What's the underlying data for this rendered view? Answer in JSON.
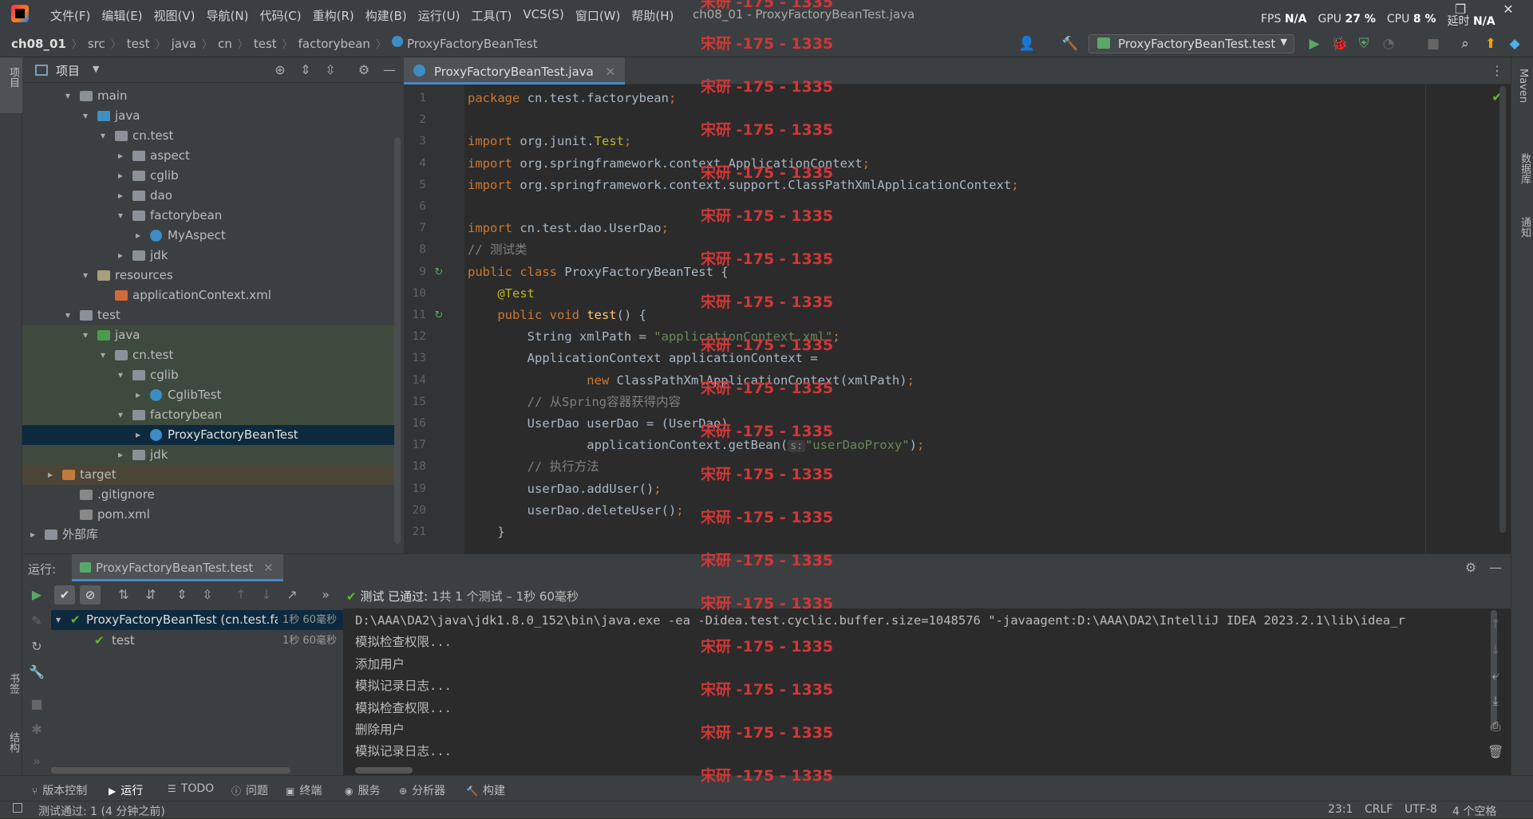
{
  "menu": [
    "文件(F)",
    "编辑(E)",
    "视图(V)",
    "导航(N)",
    "代码(C)",
    "重构(R)",
    "构建(B)",
    "运行(U)",
    "工具(T)",
    "VCS(S)",
    "窗口(W)",
    "帮助(H)"
  ],
  "window_title": "ch08_01 - ProxyFactoryBeanTest.java",
  "stats": {
    "fps_label": "FPS",
    "fps": "N/A",
    "gpu_label": "GPU",
    "gpu": "27 %",
    "cpu_label": "CPU",
    "cpu": "8 %",
    "latency_label": "延时",
    "latency": "N/A"
  },
  "breadcrumbs": [
    "ch08_01",
    "src",
    "test",
    "java",
    "cn",
    "test",
    "factorybean",
    "ProxyFactoryBeanTest"
  ],
  "run_config": "ProxyFactoryBeanTest.test",
  "left_strip": {
    "project": "项目",
    "bookmarks": "书签",
    "structure": "结构"
  },
  "right_strip": {
    "maven": "Maven",
    "database": "数据库",
    "notifications": "通知"
  },
  "project_panel": {
    "title": "项目",
    "tree": [
      {
        "label": "main",
        "depth": 2,
        "icon": "folder",
        "arrow": "▾"
      },
      {
        "label": "java",
        "depth": 3,
        "icon": "src",
        "arrow": "▾"
      },
      {
        "label": "cn.test",
        "depth": 4,
        "icon": "folder",
        "arrow": "▾"
      },
      {
        "label": "aspect",
        "depth": 5,
        "icon": "folder",
        "arrow": "▸"
      },
      {
        "label": "cglib",
        "depth": 5,
        "icon": "folder",
        "arrow": "▸"
      },
      {
        "label": "dao",
        "depth": 5,
        "icon": "folder",
        "arrow": "▸"
      },
      {
        "label": "factorybean",
        "depth": 5,
        "icon": "folder",
        "arrow": "▾"
      },
      {
        "label": "MyAspect",
        "depth": 6,
        "icon": "cls",
        "arrow": "▸"
      },
      {
        "label": "jdk",
        "depth": 5,
        "icon": "folder",
        "arrow": "▸"
      },
      {
        "label": "resources",
        "depth": 3,
        "icon": "res",
        "arrow": "▾"
      },
      {
        "label": "applicationContext.xml",
        "depth": 4,
        "icon": "xml",
        "arrow": ""
      },
      {
        "label": "test",
        "depth": 2,
        "icon": "folder",
        "arrow": "▾"
      },
      {
        "label": "java",
        "depth": 3,
        "icon": "test",
        "arrow": "▾",
        "state": "green"
      },
      {
        "label": "cn.test",
        "depth": 4,
        "icon": "folder",
        "arrow": "▾",
        "state": "green"
      },
      {
        "label": "cglib",
        "depth": 5,
        "icon": "folder",
        "arrow": "▾",
        "state": "green"
      },
      {
        "label": "CglibTest",
        "depth": 6,
        "icon": "cls",
        "arrow": "▸",
        "state": "green"
      },
      {
        "label": "factorybean",
        "depth": 5,
        "icon": "folder",
        "arrow": "▾",
        "state": "green"
      },
      {
        "label": "ProxyFactoryBeanTest",
        "depth": 6,
        "icon": "cls",
        "arrow": "▸",
        "state": "selected"
      },
      {
        "label": "jdk",
        "depth": 5,
        "icon": "folder",
        "arrow": "▸",
        "state": "green"
      },
      {
        "label": "target",
        "depth": 1,
        "icon": "target",
        "arrow": "▸",
        "state": "tan"
      },
      {
        "label": ".gitignore",
        "depth": 2,
        "icon": "file",
        "arrow": ""
      },
      {
        "label": "pom.xml",
        "depth": 2,
        "icon": "file",
        "arrow": ""
      },
      {
        "label": "外部库",
        "depth": 0,
        "icon": "folder",
        "arrow": "▸"
      }
    ]
  },
  "editor": {
    "tab": "ProxyFactoryBeanTest.java",
    "lines": [
      [
        [
          "kw",
          "package "
        ],
        [
          "",
          "cn.test.factorybean"
        ],
        [
          "kw",
          ";"
        ]
      ],
      [],
      [
        [
          "kw",
          "import "
        ],
        [
          "",
          "org.junit."
        ],
        [
          "an",
          "Test"
        ],
        [
          "kw",
          ";"
        ]
      ],
      [
        [
          "kw",
          "import "
        ],
        [
          "",
          "org.springframework.context.ApplicationContext"
        ],
        [
          "kw",
          ";"
        ]
      ],
      [
        [
          "kw",
          "import "
        ],
        [
          "",
          "org.springframework.context.support.ClassPathXmlApplicationContext"
        ],
        [
          "kw",
          ";"
        ]
      ],
      [],
      [
        [
          "kw",
          "import "
        ],
        [
          "",
          "cn.test.dao.UserDao"
        ],
        [
          "kw",
          ";"
        ]
      ],
      [
        [
          "cm",
          "// 测试类"
        ]
      ],
      [
        [
          "kw",
          "public class "
        ],
        [
          "",
          "ProxyFactoryBeanTest {"
        ]
      ],
      [
        [
          "an",
          "    @Test"
        ]
      ],
      [
        [
          "kw",
          "    public void "
        ],
        [
          "fn",
          "test"
        ],
        [
          "",
          "() {"
        ]
      ],
      [
        [
          "",
          "        String xmlPath = "
        ],
        [
          "str",
          "\"applicationContext.xml\""
        ],
        [
          "kw",
          ";"
        ]
      ],
      [
        [
          "",
          "        ApplicationContext applicationContext ="
        ]
      ],
      [
        [
          "kw",
          "                new "
        ],
        [
          "",
          "ClassPathXmlApplicationContext(xmlPath)"
        ],
        [
          "kw",
          ";"
        ]
      ],
      [
        [
          "cm",
          "        // 从Spring容器获得内容"
        ]
      ],
      [
        [
          "",
          "        UserDao userDao = (UserDao)"
        ]
      ],
      [
        [
          "",
          "                applicationContext.getBean("
        ],
        [
          "hint",
          "s:"
        ],
        [
          "str",
          "\"userDaoProxy\""
        ],
        [
          "",
          ")"
        ],
        [
          "kw",
          ";"
        ]
      ],
      [
        [
          "cm",
          "        // 执行方法"
        ]
      ],
      [
        [
          "",
          "        userDao.addUser()"
        ],
        [
          "kw",
          ";"
        ]
      ],
      [
        [
          "",
          "        userDao.deleteUser()"
        ],
        [
          "kw",
          ";"
        ]
      ],
      [
        [
          "",
          "    }"
        ]
      ]
    ]
  },
  "run": {
    "label": "运行:",
    "tab": "ProxyFactoryBeanTest.test",
    "status_prefix": "测试 已通过:",
    "status_detail": " 1共 1 个测试 – 1秒 60毫秒",
    "tree": [
      {
        "label": "ProxyFactoryBeanTest (cn.test.fa",
        "time": "1秒 60毫秒"
      },
      {
        "label": "test",
        "time": "1秒 60毫秒"
      }
    ],
    "console": [
      "D:\\AAA\\DA2\\java\\jdk1.8.0_152\\bin\\java.exe -ea -Didea.test.cyclic.buffer.size=1048576 \"-javaagent:D:\\AAA\\DA2\\IntelliJ IDEA 2023.2.1\\lib\\idea_r",
      "模拟检查权限...",
      "添加用户",
      "模拟记录日志...",
      "模拟检查权限...",
      "删除用户",
      "模拟记录日志..."
    ]
  },
  "bottom_tabs": [
    "版本控制",
    "运行",
    "TODO",
    "问题",
    "终端",
    "服务",
    "分析器",
    "构建"
  ],
  "status": {
    "message": "测试通过: 1 (4 分钟之前)",
    "position": "23:1",
    "line_ending": "CRLF",
    "encoding": "UTF-8",
    "indent": "4 个空格"
  },
  "watermark": "宋研 -175 - 1335"
}
